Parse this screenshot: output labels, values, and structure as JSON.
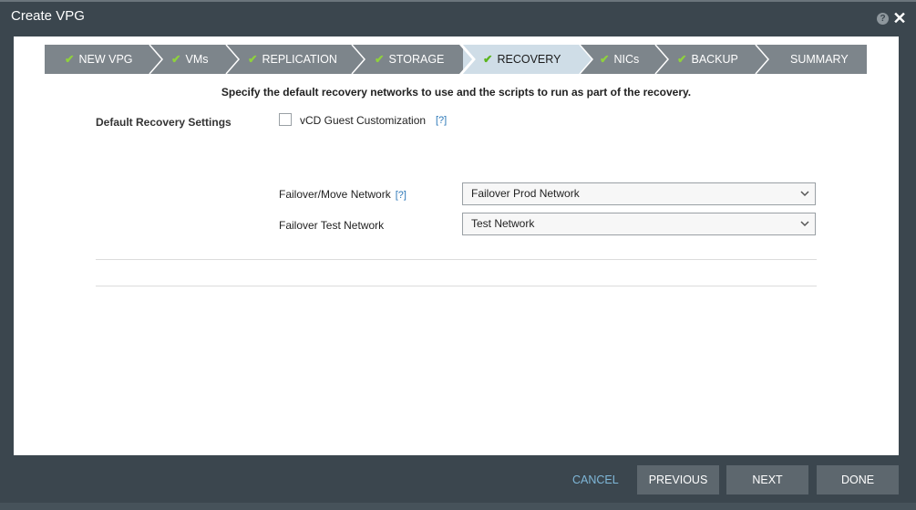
{
  "window": {
    "title": "Create VPG",
    "help_icon": "?",
    "close_icon": "✕"
  },
  "wizard": {
    "steps": [
      {
        "label": "NEW VPG",
        "done": true
      },
      {
        "label": "VMs",
        "done": true
      },
      {
        "label": "REPLICATION",
        "done": true
      },
      {
        "label": "STORAGE",
        "done": true
      },
      {
        "label": "RECOVERY",
        "done": true,
        "active": true
      },
      {
        "label": "NICs",
        "done": true
      },
      {
        "label": "BACKUP",
        "done": true
      },
      {
        "label": "SUMMARY",
        "done": false
      }
    ],
    "checkmark": "✔"
  },
  "recovery": {
    "subtitle": "Specify the default recovery networks to use and the scripts to run as part of the recovery.",
    "section_label": "Default Recovery Settings",
    "guest_customization_label": "vCD Guest Customization",
    "help_link": "[?]",
    "failover_move_label": "Failover/Move Network",
    "failover_move_value": "Failover Prod Network",
    "failover_test_label": "Failover Test Network",
    "failover_test_value": "Test Network"
  },
  "footer": {
    "cancel": "CANCEL",
    "previous": "PREVIOUS",
    "next": "NEXT",
    "done": "DONE"
  },
  "colors": {
    "step_bg": "#7d858b",
    "step_active_bg": "#cfdde7",
    "checkmark": "#8fd13d",
    "button_bg": "#5d676e",
    "cancel_link": "#7fb7d8"
  }
}
